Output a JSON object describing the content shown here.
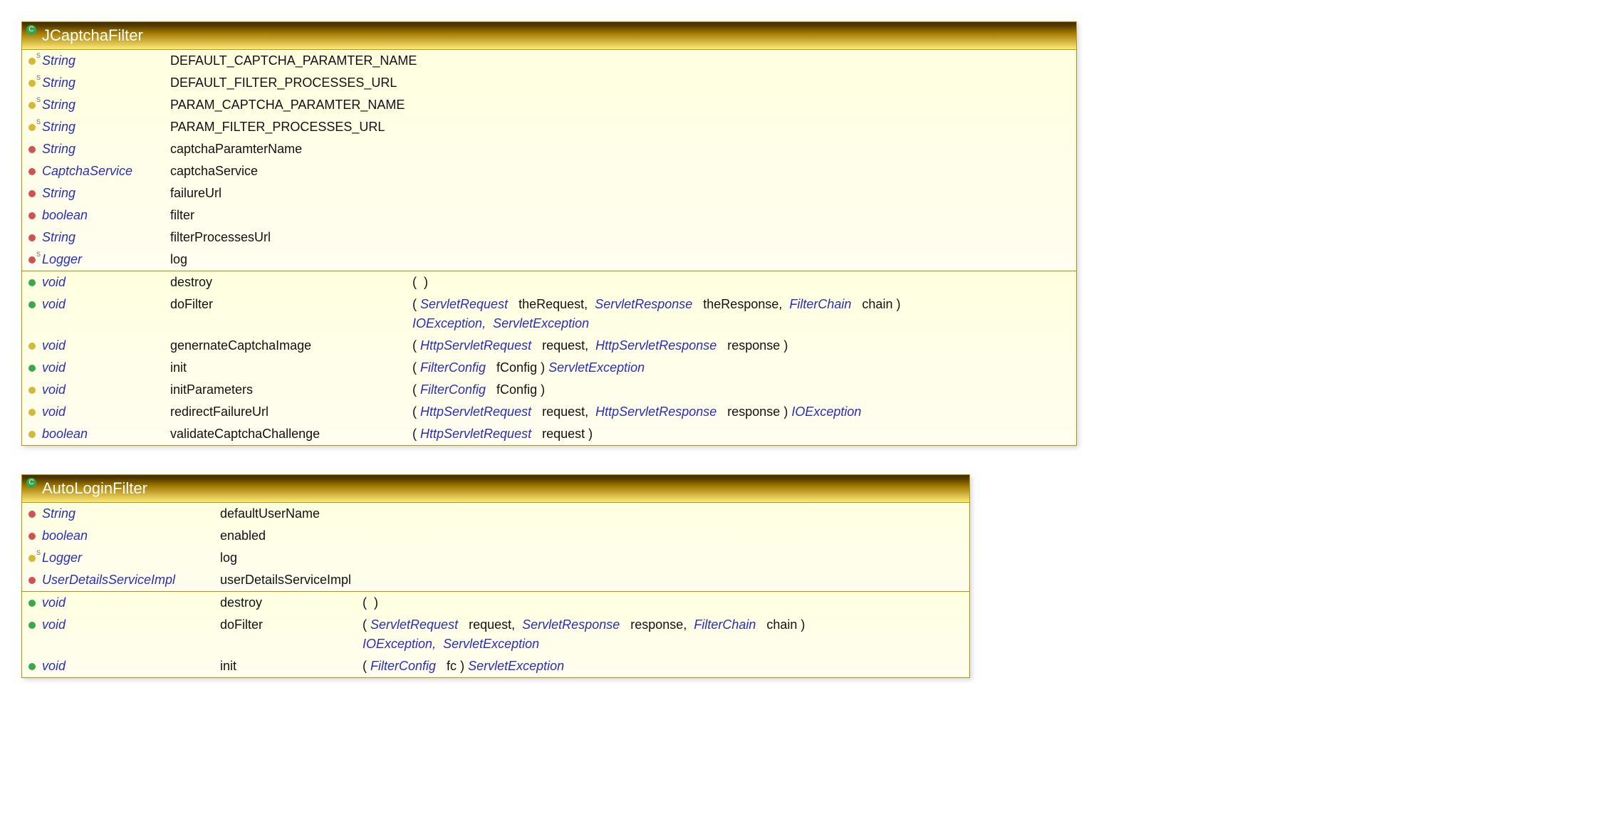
{
  "classes": [
    {
      "name": "JCaptchaFilter",
      "fields": [
        {
          "icon": "yellow",
          "static": true,
          "type": "String",
          "name": "DEFAULT_CAPTCHA_PARAMTER_NAME"
        },
        {
          "icon": "yellow",
          "static": true,
          "type": "String",
          "name": "DEFAULT_FILTER_PROCESSES_URL"
        },
        {
          "icon": "yellow",
          "static": true,
          "type": "String",
          "name": "PARAM_CAPTCHA_PARAMTER_NAME"
        },
        {
          "icon": "yellow",
          "static": true,
          "type": "String",
          "name": "PARAM_FILTER_PROCESSES_URL"
        },
        {
          "icon": "red",
          "static": false,
          "type": "String",
          "name": "captchaParamterName"
        },
        {
          "icon": "red",
          "static": false,
          "type": "CaptchaService",
          "name": "captchaService"
        },
        {
          "icon": "red",
          "static": false,
          "type": "String",
          "name": "failureUrl"
        },
        {
          "icon": "red",
          "static": false,
          "type": "boolean",
          "name": "filter"
        },
        {
          "icon": "red",
          "static": false,
          "type": "String",
          "name": "filterProcessesUrl"
        },
        {
          "icon": "red",
          "static": true,
          "type": "Logger",
          "name": "log"
        }
      ],
      "methods": [
        {
          "icon": "green",
          "ret": "void",
          "name": "destroy",
          "params": [],
          "throws": []
        },
        {
          "icon": "green",
          "ret": "void",
          "name": "doFilter",
          "params": [
            {
              "type": "ServletRequest",
              "name": "theRequest"
            },
            {
              "type": "ServletResponse",
              "name": "theResponse"
            },
            {
              "type": "FilterChain",
              "name": "chain"
            }
          ],
          "throws": [
            "IOException",
            "ServletException"
          ]
        },
        {
          "icon": "yellow",
          "ret": "void",
          "name": "genernateCaptchaImage",
          "params": [
            {
              "type": "HttpServletRequest",
              "name": "request"
            },
            {
              "type": "HttpServletResponse",
              "name": "response"
            }
          ],
          "throws": []
        },
        {
          "icon": "green",
          "ret": "void",
          "name": "init",
          "params": [
            {
              "type": "FilterConfig",
              "name": "fConfig"
            }
          ],
          "throws": [
            "ServletException"
          ]
        },
        {
          "icon": "yellow",
          "ret": "void",
          "name": "initParameters",
          "params": [
            {
              "type": "FilterConfig",
              "name": "fConfig"
            }
          ],
          "throws": []
        },
        {
          "icon": "yellow",
          "ret": "void",
          "name": "redirectFailureUrl",
          "params": [
            {
              "type": "HttpServletRequest",
              "name": "request"
            },
            {
              "type": "HttpServletResponse",
              "name": "response"
            }
          ],
          "throws": [
            "IOException"
          ]
        },
        {
          "icon": "yellow",
          "ret": "boolean",
          "name": "validateCaptchaChallenge",
          "params": [
            {
              "type": "HttpServletRequest",
              "name": "request"
            }
          ],
          "throws": []
        }
      ]
    },
    {
      "name": "AutoLoginFilter",
      "fields": [
        {
          "icon": "red",
          "static": false,
          "type": "String",
          "name": "defaultUserName"
        },
        {
          "icon": "red",
          "static": false,
          "type": "boolean",
          "name": "enabled"
        },
        {
          "icon": "yellow",
          "static": true,
          "type": "Logger",
          "name": "log"
        },
        {
          "icon": "red",
          "static": false,
          "type": "UserDetailsServiceImpl",
          "name": "userDetailsServiceImpl"
        }
      ],
      "methods": [
        {
          "icon": "green",
          "ret": "void",
          "name": "destroy",
          "params": [],
          "throws": []
        },
        {
          "icon": "green",
          "ret": "void",
          "name": "doFilter",
          "params": [
            {
              "type": "ServletRequest",
              "name": "request"
            },
            {
              "type": "ServletResponse",
              "name": "response"
            },
            {
              "type": "FilterChain",
              "name": "chain"
            }
          ],
          "throws": [
            "IOException",
            "ServletException"
          ]
        },
        {
          "icon": "green",
          "ret": "void",
          "name": "init",
          "params": [
            {
              "type": "FilterConfig",
              "name": "fc"
            }
          ],
          "throws": [
            "ServletException"
          ]
        }
      ]
    }
  ]
}
